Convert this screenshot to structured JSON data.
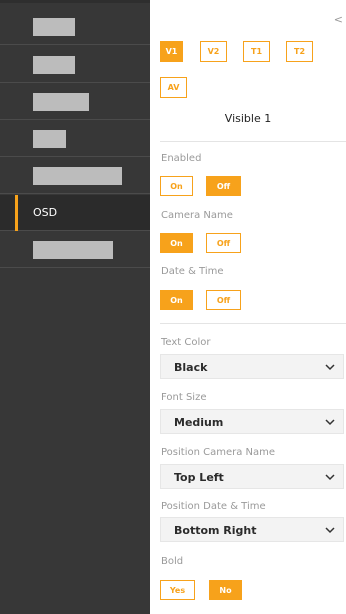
{
  "sidebar": {
    "active_label": "OSD"
  },
  "panel": {
    "collapse_glyph": "<",
    "video_tabs": [
      "V1",
      "V2",
      "T1",
      "T2",
      "AV"
    ],
    "selected_tab": "V1",
    "title": "Visible 1",
    "enabled": {
      "label": "Enabled",
      "on": "On",
      "off": "Off",
      "value": "Off"
    },
    "camera_name": {
      "label": "Camera Name",
      "on": "On",
      "off": "Off",
      "value": "On"
    },
    "date_time": {
      "label": "Date & Time",
      "on": "On",
      "off": "Off",
      "value": "On"
    },
    "text_color": {
      "label": "Text Color",
      "value": "Black"
    },
    "font_size": {
      "label": "Font Size",
      "value": "Medium"
    },
    "position_camera_name": {
      "label": "Position Camera Name",
      "value": "Top Left"
    },
    "position_date_time": {
      "label": "Position Date & Time",
      "value": "Bottom Right"
    },
    "bold": {
      "label": "Bold",
      "yes": "Yes",
      "no": "No",
      "value": "No"
    }
  },
  "colors": {
    "accent": "#f7a21b",
    "sidebar_bg": "#373737"
  }
}
